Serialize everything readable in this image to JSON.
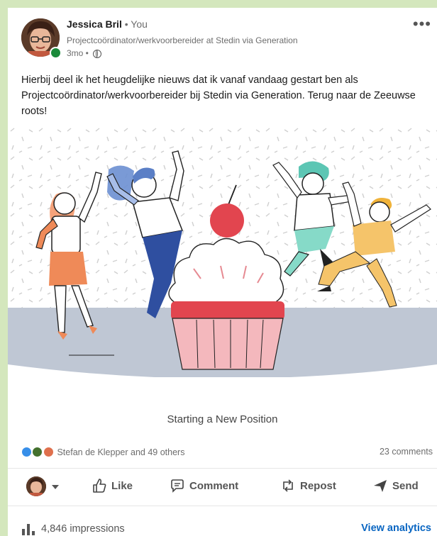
{
  "post": {
    "author_name": "Jessica Bril",
    "author_relation": "• You",
    "headline": "Projectcoördinator/werkvoorbereider at Stedin via Generation",
    "time": "3mo •",
    "text": "Hierbij deel ik het heugdelijke nieuws dat ik vanaf vandaag gestart ben als Projectcoördinator/werkvoorbereider bij Stedin via Generation. Terug naar de Zeeuwse roots!",
    "caption": "Starting a New Position"
  },
  "social": {
    "reactions_text": "Stefan de Klepper and 49 others",
    "comments_text": "23 comments"
  },
  "actions": {
    "like": "Like",
    "comment": "Comment",
    "repost": "Repost",
    "send": "Send"
  },
  "analytics": {
    "impressions": "4,846 impressions",
    "view_label": "View analytics"
  },
  "icons": {
    "more": "more-options-icon",
    "globe": "globe-icon",
    "like": "thumbs-up-icon",
    "comment": "comment-bubble-icon",
    "repost": "repost-icon",
    "send": "send-arrow-icon",
    "impressions": "bar-chart-icon"
  },
  "colors": {
    "page_background": "#d4e7bd",
    "link_blue": "#0a66c2",
    "online_green": "#1b8a3a",
    "cupcake_pink": "#f4b8bd",
    "cherry_red": "#e2454f"
  }
}
